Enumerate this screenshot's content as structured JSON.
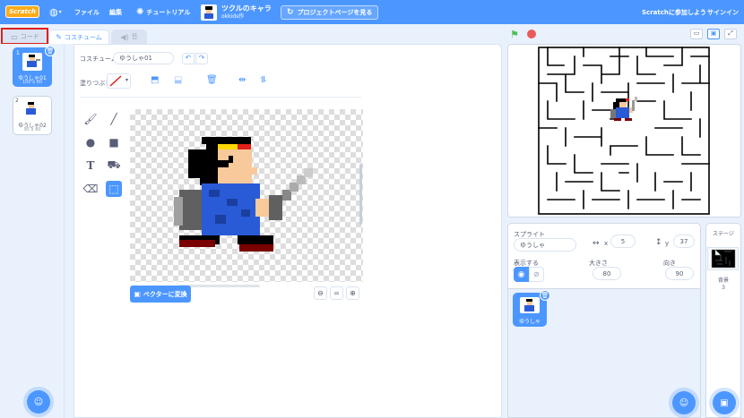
{
  "menubar": {
    "logo": "Scratch",
    "file": "ファイル",
    "edit": "編集",
    "tutorial": "チュートリアル",
    "project_title": "ツクルのキャラ",
    "project_author": "okkids作",
    "project_page": "プロジェクトページを見る",
    "join": "Scratchに参加しよう",
    "signin": "サインイン"
  },
  "tabs": {
    "code": "コード",
    "costume": "コスチューム",
    "sound": "音"
  },
  "costumes": [
    {
      "num": "1",
      "name": "ゆうしゃ01",
      "size": "100 x 80"
    },
    {
      "num": "2",
      "name": "ゆうしゃ02",
      "size": "95 x 80"
    }
  ],
  "editor": {
    "costume_label": "コスチューム",
    "costume_name": "ゆうしゃ01",
    "fill_label": "塗りつぶし",
    "convert_button": "ベクターに変換",
    "zoom_reset": "="
  },
  "sprite_info": {
    "sprite_label": "スプライト",
    "sprite_name": "ゆうしゃ",
    "x_label": "x",
    "x_value": "5",
    "y_label": "y",
    "y_value": "37",
    "show_label": "表示する",
    "size_label": "大きさ",
    "size_value": "80",
    "direction_label": "向き",
    "direction_value": "90"
  },
  "sprite_list": [
    {
      "name": "ゆうしゃ"
    }
  ],
  "stage_pane": {
    "title": "ステージ",
    "backdrops_label": "背景",
    "backdrops_count": "3"
  },
  "colors": {
    "accent": "#4c97ff",
    "menubar": "#4c97ff",
    "highlight": "#e0201a",
    "green_flag": "#4cbf56",
    "stop": "#ec5959"
  }
}
